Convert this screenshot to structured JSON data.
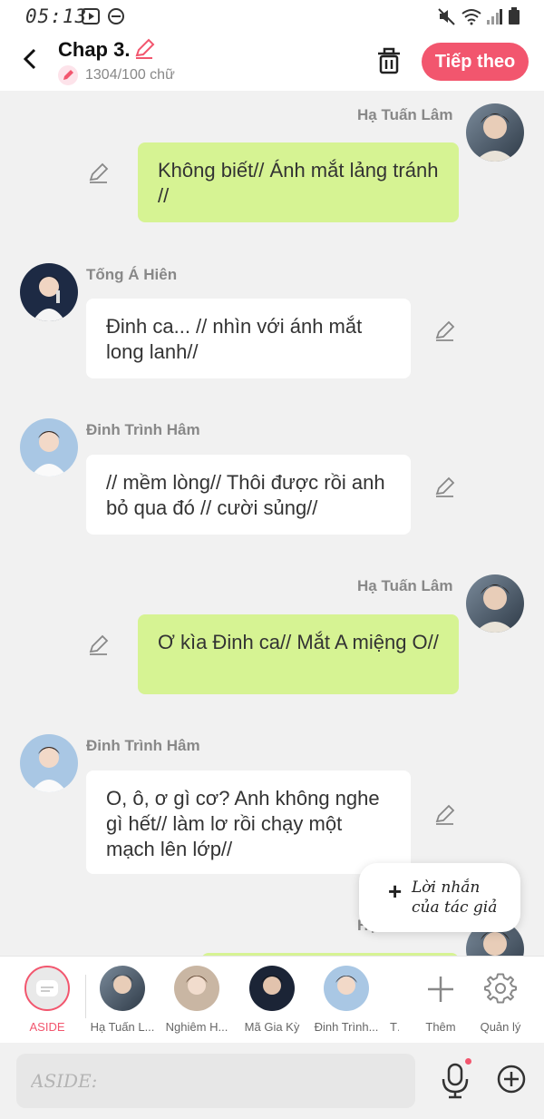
{
  "status_bar": {
    "time": "05:13"
  },
  "header": {
    "title": "Chap 3.",
    "word_count": "1304/100 chữ",
    "next_label": "Tiếp theo"
  },
  "colors": {
    "accent": "#f2566e",
    "bubble_right": "#d6f393",
    "bubble_left": "#ffffff",
    "background": "#f1f1f1"
  },
  "messages": [
    {
      "speaker": "Hạ Tuấn Lâm",
      "side": "right",
      "text": "Không biết// Ánh mắt  lảng tránh //"
    },
    {
      "speaker": "Tống Á Hiên",
      "side": "left",
      "text": "Đinh ca... // nhìn với ánh mắt long lanh//"
    },
    {
      "speaker": "Đinh Trình Hâm",
      "side": "left",
      "text": "// mềm lòng// Thôi được rồi anh bỏ qua đó // cười sủng//"
    },
    {
      "speaker": "Hạ Tuấn Lâm",
      "side": "right",
      "text": "Ơ kìa Đinh ca// Mắt A miệng O//"
    },
    {
      "speaker": "Đinh Trình Hâm",
      "side": "left",
      "text": "O, ô, ơ gì cơ? Anh không nghe gì hết// làm lơ rồi chạy một mạch lên lớp//"
    },
    {
      "speaker": "Hạ",
      "side": "right",
      "text": ""
    }
  ],
  "author_note": {
    "plus": "+",
    "line1": "Lời nhắn",
    "line2": "của tác giả"
  },
  "characters": [
    {
      "label": "ASIDE"
    },
    {
      "label": "Hạ Tuấn L..."
    },
    {
      "label": "Nghiêm H..."
    },
    {
      "label": "Mã Gia Kỳ"
    },
    {
      "label": "Đinh Trình..."
    },
    {
      "label": "Tr"
    }
  ],
  "tools": {
    "add_label": "Thêm",
    "manage_label": "Quản lý"
  },
  "input": {
    "placeholder": "ASIDE:"
  }
}
